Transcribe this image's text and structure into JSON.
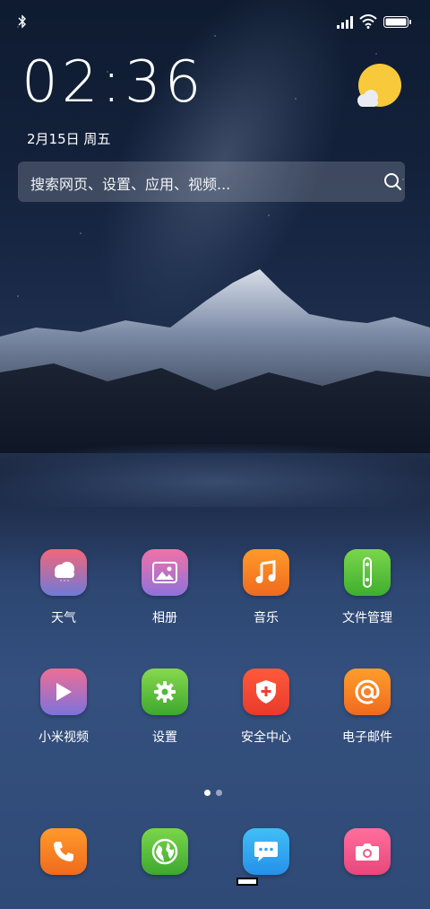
{
  "status_bar": {
    "bluetooth_icon": "bluetooth-icon",
    "signal_icon": "signal-icon",
    "wifi_icon": "wifi-icon",
    "battery_icon": "battery-icon"
  },
  "lockscreen": {
    "time": "02:36",
    "date": "2月15日 周五",
    "weather_icon": "sun-cloud-icon"
  },
  "search": {
    "placeholder": "搜索网页、设置、应用、视频...",
    "icon": "search-icon"
  },
  "apps": [
    {
      "label": "天气",
      "icon": "weather-icon",
      "color_top": "#f3667a",
      "color_bottom": "#6e7ad8"
    },
    {
      "label": "相册",
      "icon": "gallery-icon",
      "color_top": "#f072a6",
      "color_bottom": "#8e72dc"
    },
    {
      "label": "音乐",
      "icon": "music-icon",
      "color_top": "#ff9a2a",
      "color_bottom": "#f06a1e"
    },
    {
      "label": "文件管理",
      "icon": "file-manager-icon",
      "color_top": "#7ad64a",
      "color_bottom": "#3fae2e"
    },
    {
      "label": "小米视频",
      "icon": "video-icon",
      "color_top": "#f06d96",
      "color_bottom": "#7c72dc"
    },
    {
      "label": "设置",
      "icon": "settings-gear-icon",
      "color_top": "#86d84c",
      "color_bottom": "#3ea82f"
    },
    {
      "label": "安全中心",
      "icon": "security-shield-icon",
      "color_top": "#ff5a3c",
      "color_bottom": "#e93a2a"
    },
    {
      "label": "电子邮件",
      "icon": "email-at-icon",
      "color_top": "#ff9d2b",
      "color_bottom": "#f06a1e"
    }
  ],
  "dock": [
    {
      "icon": "phone-icon",
      "color_top": "#ff9a2a",
      "color_bottom": "#f06a1e"
    },
    {
      "icon": "browser-globe-icon",
      "color_top": "#7ad64a",
      "color_bottom": "#3ea82f"
    },
    {
      "icon": "messages-icon",
      "color_top": "#41bff6",
      "color_bottom": "#2590e8"
    },
    {
      "icon": "camera-icon",
      "color_top": "#ff6f9c",
      "color_bottom": "#e9467c"
    }
  ],
  "page_indicator": {
    "pages": 2,
    "current": 1,
    "active_color": "#ffffff",
    "inactive_color": "#9aa6bd"
  }
}
